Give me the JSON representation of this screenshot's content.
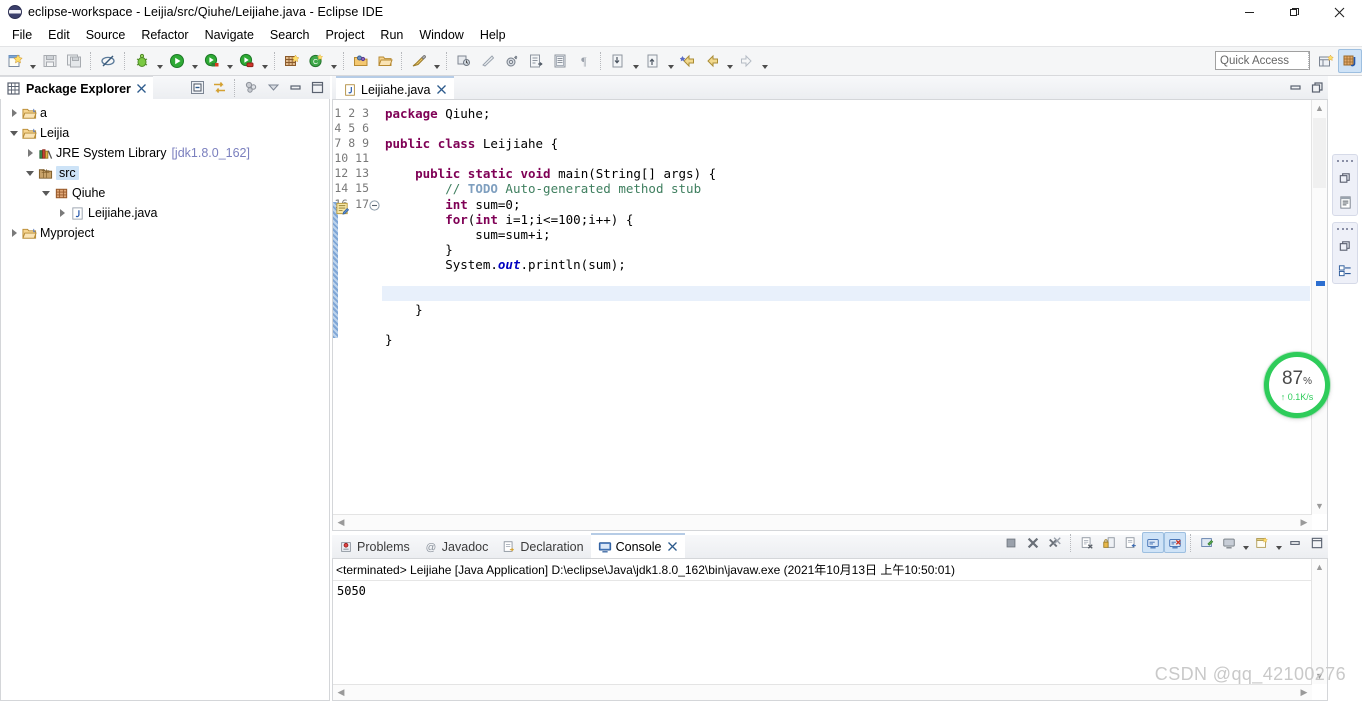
{
  "window": {
    "title": "eclipse-workspace - Leijia/src/Qiuhe/Leijiahe.java - Eclipse IDE",
    "app_icon": "eclipse-icon",
    "minimize": "–",
    "maximize": "❐",
    "close": "✕"
  },
  "menu": {
    "items": [
      {
        "label": "File"
      },
      {
        "label": "Edit"
      },
      {
        "label": "Source"
      },
      {
        "label": "Refactor"
      },
      {
        "label": "Navigate"
      },
      {
        "label": "Search"
      },
      {
        "label": "Project"
      },
      {
        "label": "Run"
      },
      {
        "label": "Window"
      },
      {
        "label": "Help"
      }
    ]
  },
  "toolbar": {
    "quick_access_placeholder": "Quick Access",
    "icons": [
      "new-wizard-icon",
      "save-icon",
      "save-all-icon",
      "no-link-icon",
      "debug-icon",
      "run-icon",
      "run-as-icon",
      "coverage-icon",
      "new-java-project-icon",
      "new-class-icon",
      "open-type-icon",
      "open-resource-icon",
      "search-icon",
      "open-task-icon",
      "skip-breakpoints-icon",
      "external-tools-icon",
      "toggle-mark-occurrences-icon",
      "show-whitespace-icon",
      "pilcrow-icon",
      "next-annotation-icon",
      "previous-annotation-icon",
      "last-edit-location-icon",
      "back-icon",
      "forward-icon"
    ],
    "perspective": {
      "open_perspective": "open-perspective-icon",
      "java_perspective": "java-perspective-icon"
    }
  },
  "package_explorer": {
    "tab_label": "Package Explorer",
    "tab_icon": "package-explorer-icon",
    "close_icon": "close-tab-icon",
    "tools": [
      "collapse-all-icon",
      "link-with-editor-icon",
      "view-menu-filter-icon",
      "view-menu-icon",
      "minimize-icon",
      "maximize-icon"
    ],
    "tree": [
      {
        "label": "a",
        "icon": "project-icon",
        "indent": 0,
        "state": "closed",
        "selected": false
      },
      {
        "label": "Leijia",
        "icon": "project-icon",
        "indent": 0,
        "state": "open",
        "selected": false
      },
      {
        "label": "JRE System Library",
        "suffix": "[jdk1.8.0_162]",
        "icon": "library-icon",
        "indent": 1,
        "state": "closed",
        "selected": false
      },
      {
        "label": "src",
        "icon": "source-folder-icon",
        "indent": 1,
        "state": "open",
        "selected": true
      },
      {
        "label": "Qiuhe",
        "icon": "package-icon",
        "indent": 2,
        "state": "open",
        "selected": false
      },
      {
        "label": "Leijiahe.java",
        "icon": "java-file-icon",
        "indent": 3,
        "state": "closed",
        "selected": false
      },
      {
        "label": "Myproject",
        "icon": "project-icon",
        "indent": 0,
        "state": "closed",
        "selected": false
      }
    ]
  },
  "editor": {
    "tab_label": "Leijiahe.java",
    "tab_icon": "java-file-icon",
    "close_icon": "close-tab-icon",
    "tools": [
      "minimize-icon",
      "restore-icon"
    ],
    "highlighted_line": 13,
    "line_numbers": [
      "1",
      "2",
      "3",
      "4",
      "5",
      "6",
      "7",
      "8",
      "9",
      "10",
      "11",
      "12",
      "13",
      "14",
      "15",
      "16",
      "17"
    ],
    "lines": [
      "package Qiuhe;",
      "",
      "public class Leijiahe {",
      "",
      "    public static void main(String[] args) {",
      "        // TODO Auto-generated method stub",
      "        int sum=0;",
      "        for(int i=1;i<=100;i++) {",
      "            sum=sum+i;",
      "        }",
      "        System.out.println(sum);",
      "",
      "",
      "    }",
      "",
      "}",
      ""
    ]
  },
  "console_panel": {
    "tabs": [
      {
        "label": "Problems",
        "icon": "problems-icon",
        "active": false
      },
      {
        "label": "Javadoc",
        "icon": "javadoc-icon",
        "active": false
      },
      {
        "label": "Declaration",
        "icon": "declaration-icon",
        "active": false
      },
      {
        "label": "Console",
        "icon": "console-icon",
        "active": true
      }
    ],
    "close_icon": "close-tab-icon",
    "tools": [
      "terminate-icon",
      "remove-launch-icon",
      "remove-all-launches-icon",
      "clear-console-icon",
      "scroll-lock-icon",
      "word-wrap-icon",
      "show-console-on-output-icon",
      "show-console-on-error-icon",
      "pin-console-icon",
      "display-selected-console-icon",
      "open-console-icon",
      "minimize-icon",
      "maximize-icon"
    ],
    "terminated_line": "<terminated> Leijiahe [Java Application] D:\\eclipse\\Java\\jdk1.8.0_162\\bin\\javaw.exe (2021年10月13日 上午10:50:01)",
    "output": "5050"
  },
  "right_bar": {
    "groups": [
      {
        "icons": [
          "restore-icon",
          "outline-view-icon"
        ]
      },
      {
        "icons": [
          "restore-icon",
          "task-list-icon"
        ]
      }
    ]
  },
  "network_widget": {
    "percent": "87",
    "percent_symbol": "%",
    "speed": "↑ 0.1K/s",
    "accent": "#2ecc5a"
  },
  "watermark": {
    "text": "CSDN @qq_42100276"
  }
}
